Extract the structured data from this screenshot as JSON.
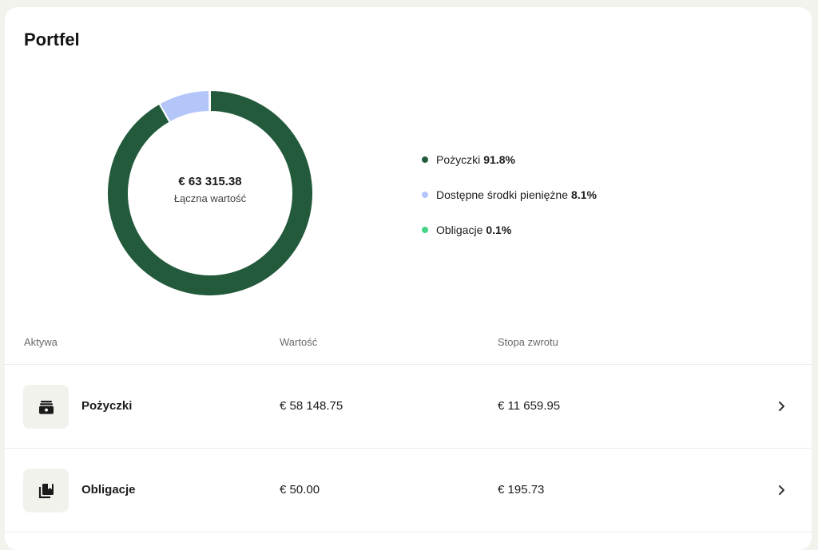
{
  "portfolio": {
    "title": "Portfel",
    "total_value": "€ 63 315.38",
    "total_label": "Łączna wartość"
  },
  "allocation": [
    {
      "name": "Pożyczki",
      "percent_label": "91.8%",
      "percent": 91.8,
      "color": "#235a3c"
    },
    {
      "name": "Dostępne środki pieniężne",
      "percent_label": "8.1%",
      "percent": 8.1,
      "color": "#b4c5fa"
    },
    {
      "name": "Obligacje",
      "percent_label": "0.1%",
      "percent": 0.1,
      "color": "#43d486"
    }
  ],
  "table": {
    "headers": {
      "asset": "Aktywa",
      "value": "Wartość",
      "return": "Stopa zwrotu"
    },
    "rows": [
      {
        "name": "Pożyczki",
        "value": "€ 58 148.75",
        "return": "€ 11 659.95",
        "icon": "wallet-icon"
      },
      {
        "name": "Obligacje",
        "value": "€ 50.00",
        "return": "€ 195.73",
        "icon": "bond-icon"
      }
    ]
  },
  "colors": {
    "accent": "#235a3c",
    "background": "#f3f3ee",
    "card": "#ffffff"
  }
}
